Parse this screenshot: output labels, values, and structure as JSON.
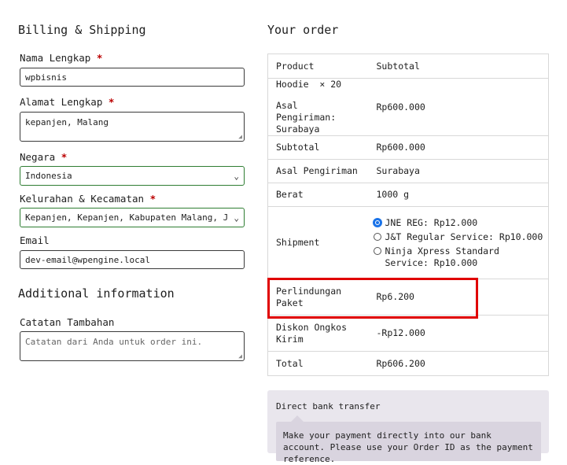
{
  "billing": {
    "title": "Billing & Shipping",
    "fields": {
      "nama": {
        "label": "Nama Lengkap",
        "value": "wpbisnis"
      },
      "alamat": {
        "label": "Alamat Lengkap",
        "value": "kepanjen, Malang"
      },
      "negara": {
        "label": "Negara",
        "value": "Indonesia"
      },
      "kelurahan": {
        "label": "Kelurahan & Kecamatan",
        "value": "Kepanjen, Kepanjen, Kabupaten Malang, Jawa Ti..."
      },
      "email": {
        "label": "Email",
        "value": "dev-email@wpengine.local"
      }
    },
    "required_mark": "*"
  },
  "additional": {
    "title": "Additional information",
    "catatan": {
      "label": "Catatan Tambahan",
      "placeholder": "Catatan dari Anda untuk order ini."
    }
  },
  "order": {
    "title": "Your order",
    "header": {
      "product": "Product",
      "subtotal": "Subtotal"
    },
    "item": {
      "name": "Hoodie",
      "qty": "× 20",
      "origin_label": "Asal Pengiriman:",
      "origin_value": "Surabaya",
      "price": "Rp600.000"
    },
    "rows": {
      "subtotal": {
        "label": "Subtotal",
        "value": "Rp600.000"
      },
      "asal": {
        "label": "Asal Pengiriman",
        "value": "Surabaya"
      },
      "berat": {
        "label": "Berat",
        "value": "1000 g"
      },
      "shipment": {
        "label": "Shipment",
        "options": [
          {
            "text": "JNE REG: Rp12.000",
            "selected": true
          },
          {
            "text": "J&T Regular Service: Rp10.000",
            "selected": false
          },
          {
            "text": "Ninja Xpress Standard Service: Rp10.000",
            "selected": false
          }
        ]
      },
      "perlindungan": {
        "label": "Perlindungan Paket",
        "value": "Rp6.200"
      },
      "diskon": {
        "label": "Diskon Ongkos Kirim",
        "value": "-Rp12.000"
      },
      "total": {
        "label": "Total",
        "value": "Rp606.200"
      }
    }
  },
  "payment": {
    "method": "Direct bank transfer",
    "description": "Make your payment directly into our bank account. Please use your Order ID as the payment reference."
  },
  "colors": {
    "required": "#bb0000",
    "highlight": "#e00000",
    "radio_selected": "#1a73e8",
    "valid_border": "#2e7d32"
  }
}
